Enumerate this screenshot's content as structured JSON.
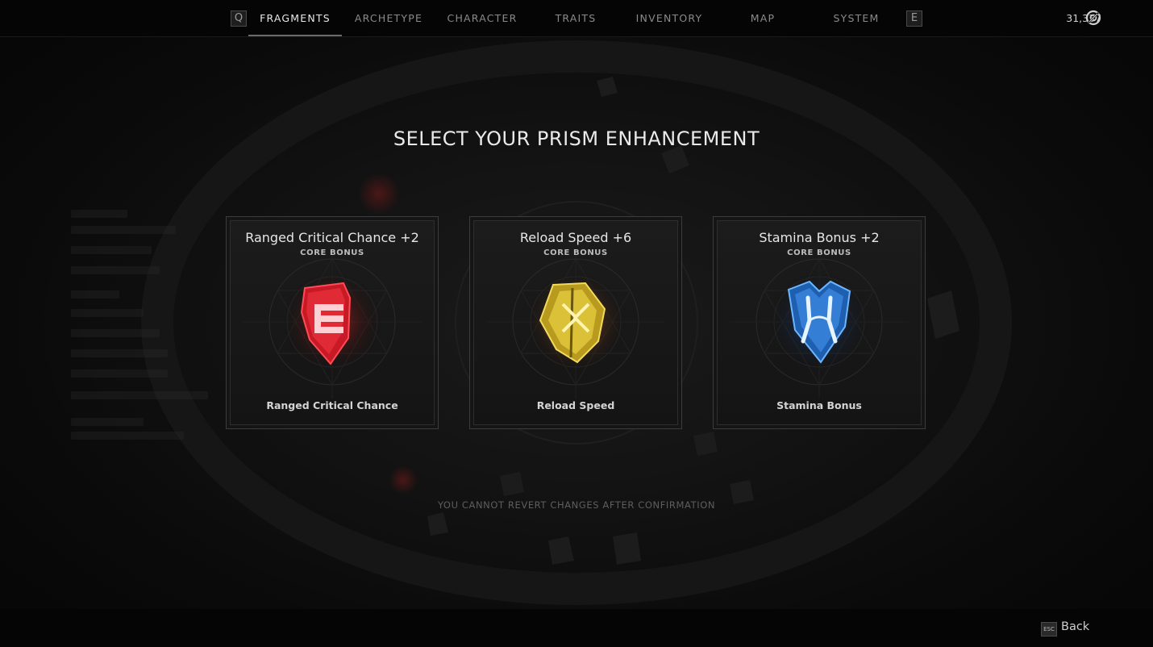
{
  "nav": {
    "prev_key": "Q",
    "next_key": "E",
    "tabs": [
      {
        "label": "FRAGMENTS",
        "active": true
      },
      {
        "label": "ARCHETYPE",
        "active": false
      },
      {
        "label": "CHARACTER",
        "active": false
      },
      {
        "label": "TRAITS",
        "active": false
      },
      {
        "label": "INVENTORY",
        "active": false
      },
      {
        "label": "MAP",
        "active": false
      },
      {
        "label": "SYSTEM",
        "active": false
      }
    ],
    "currency_amount": "31,337",
    "currency_icon": "scrap-currency-icon"
  },
  "title": "SELECT YOUR PRISM ENHANCEMENT",
  "cards": [
    {
      "title": "Ranged Critical Chance +2",
      "subtitle": "CORE BONUS",
      "name": "Ranged Critical Chance",
      "gem_color": "#e0242f",
      "gem_icon": "red-fragment-icon"
    },
    {
      "title": "Reload Speed +6",
      "subtitle": "CORE BONUS",
      "name": "Reload Speed",
      "gem_color": "#d9c23a",
      "gem_icon": "yellow-fragment-icon"
    },
    {
      "title": "Stamina Bonus +2",
      "subtitle": "CORE BONUS",
      "name": "Stamina Bonus",
      "gem_color": "#3f8fe6",
      "gem_icon": "blue-fragment-icon"
    }
  ],
  "warning": "YOU CANNOT REVERT CHANGES AFTER CONFIRMATION",
  "footer": {
    "back_key": "ESC",
    "back_label": "Back"
  }
}
